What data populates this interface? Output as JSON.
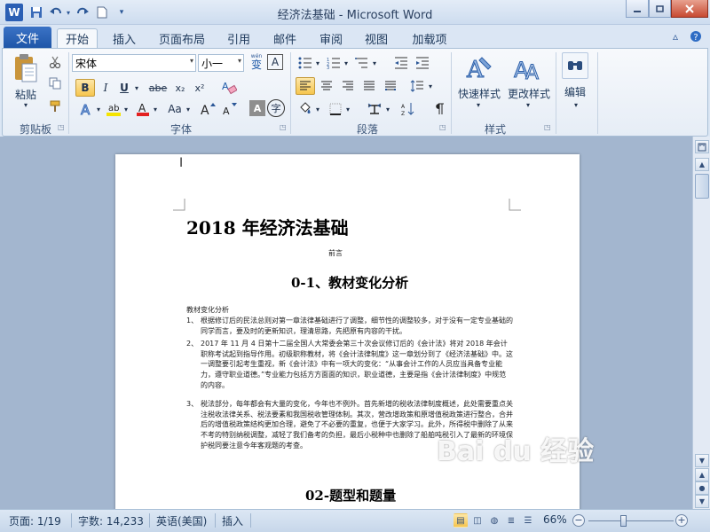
{
  "window": {
    "title": "经济法基础 - Microsoft Word",
    "app_logo": "W",
    "minimize_icon": "minimize-icon",
    "maximize_icon": "restore-icon",
    "close_icon": "close-icon"
  },
  "quick_access": [
    "save-icon",
    "undo-icon",
    "redo-icon",
    "new-document-icon",
    "customize-qat-icon"
  ],
  "tabs": {
    "file": "文件",
    "items": [
      "开始",
      "插入",
      "页面布局",
      "引用",
      "邮件",
      "审阅",
      "视图",
      "加载项"
    ],
    "active_index": 0
  },
  "ribbon": {
    "clipboard": {
      "paste_label": "粘贴",
      "group_label": "剪贴板"
    },
    "font": {
      "font_name": "宋体",
      "font_size": "小一",
      "wen_icon_glyph": "wén",
      "wen_icon_char": "变",
      "border_char": "A",
      "bold": "B",
      "italic": "I",
      "underline": "U",
      "strikethrough": "abe",
      "subscript": "x₂",
      "superscript": "x²",
      "grow": "A",
      "change_case": "Aa",
      "enclose_char": "字",
      "group_label": "字体"
    },
    "paragraph": {
      "group_label": "段落"
    },
    "styles": {
      "quick_styles": "快速样式",
      "change_styles": "更改样式",
      "group_label": "样式"
    },
    "editing": {
      "label": "编辑"
    }
  },
  "document": {
    "title": "2018 年经济法基础",
    "preface": "前言",
    "section1": "0-1、教材变化分析",
    "subhead": "教材变化分析",
    "items": [
      {
        "num": "1、",
        "text": "根据修订后的民法总则对第一章法律基础进行了调整，细节性的调整较多，对于没有一定专业基础的同学而言，要及时的更新知识，理清思路，先把原有内容的干扰。"
      },
      {
        "num": "2、",
        "text": "2017 年 11 月 4 日第十二届全国人大常委会第三十次会议修订后的《会计法》将对 2018 年会计职称考试起到指导作用。初级职称教材，将《会计法律制度》这一章划分到了《经济法基础》中。这一调整要引起考生重视，新《会计法》中有一项大的变化：“从事会计工作的人员应当具备专业能力，遵守职业道德。”专业能力包括方方面面的知识，职业道德，主要是指《会计法律制度》中规范的内容。"
      },
      {
        "num": "3、",
        "text": "税法部分，每年都会有大量的变化，今年也不例外。首先新增的税收法律制度概述，此处需要重点关注税收法律关系、税法要素和我国税收管理体制。其次，营改增政策和原增值税政策进行整合，合并后的增值税政策结构更加合理，避免了不必要的重复，也便于大家学习。此外，所得税中删除了从来不考的特别纳税调整，减轻了我们备考的负担，最后小税种中也删除了船舶吨税引入了最新的环境保护税同要注意今年客观题的考查。"
      }
    ],
    "section2": "02-题型和题量"
  },
  "watermark": "Bai du 经验",
  "status_bar": {
    "page": "页面: 1/19",
    "words": "字数: 14,233",
    "language": "英语(美国)",
    "mode": "插入",
    "zoom": "66%",
    "zoom_fraction": 0.42
  },
  "colors": {
    "accent": "#2b5797",
    "file_tab": "#2a62b5",
    "ribbon_bg": "#eef3fa",
    "workspace": "#a3b6cf",
    "highlight_yellow": "#f5e400",
    "font_red": "#e32020"
  }
}
